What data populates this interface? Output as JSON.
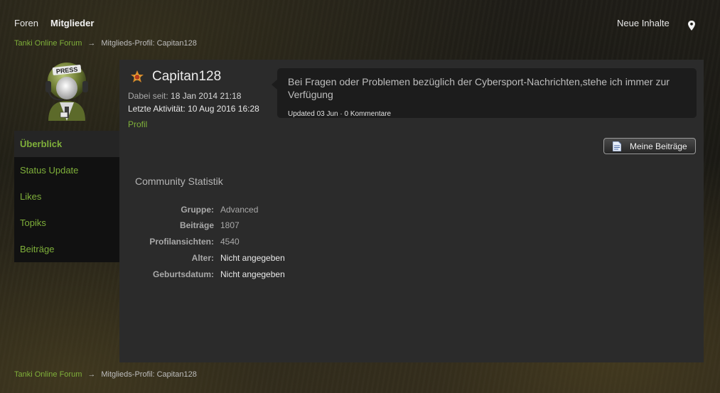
{
  "nav": {
    "foren": "Foren",
    "mitglieder": "Mitglieder",
    "neue_inhalte": "Neue Inhalte",
    "location_icon": "map-pin-icon"
  },
  "breadcrumb": {
    "home": "Tanki Online Forum",
    "separator": "→",
    "current": "Mitglieds-Profil: Capitan128"
  },
  "profile": {
    "username": "Capitan128",
    "rank_icon": "rank-star-icon",
    "joined_label": "Dabei seit:",
    "joined_value": "18 Jan 2014 21:18",
    "last_active_label": "Letzte Aktivität:",
    "last_active_value": "10 Aug 2016 16:28",
    "profile_link": "Profil",
    "avatar": "press-helmet-avatar"
  },
  "status": {
    "text": "Bei Fragen oder Problemen bezüglich der Cybersport-Nachrichten,stehe ich immer zur Verfügung",
    "updated": "Updated 03 Jun",
    "separator": "·",
    "comments": "0 Kommentare"
  },
  "sidebar": {
    "items": [
      {
        "label": "Überblick",
        "active": true
      },
      {
        "label": "Status Update"
      },
      {
        "label": "Likes"
      },
      {
        "label": "Topiks"
      },
      {
        "label": "Beiträge"
      }
    ]
  },
  "buttons": {
    "meine_beitraege": "Meine Beiträge"
  },
  "stats": {
    "title": "Community Statistik",
    "rows": [
      {
        "label": "Gruppe:",
        "value": "Advanced"
      },
      {
        "label": "Beiträge",
        "value": "1807"
      },
      {
        "label": "Profilansichten:",
        "value": "4540"
      },
      {
        "label": "Alter:",
        "value": "Nicht angegeben"
      },
      {
        "label": "Geburtsdatum:",
        "value": "Nicht angegeben"
      }
    ]
  },
  "colors": {
    "accent_green": "#7fb03a",
    "panel": "#2b2b2b",
    "sidebar": "#111111"
  }
}
